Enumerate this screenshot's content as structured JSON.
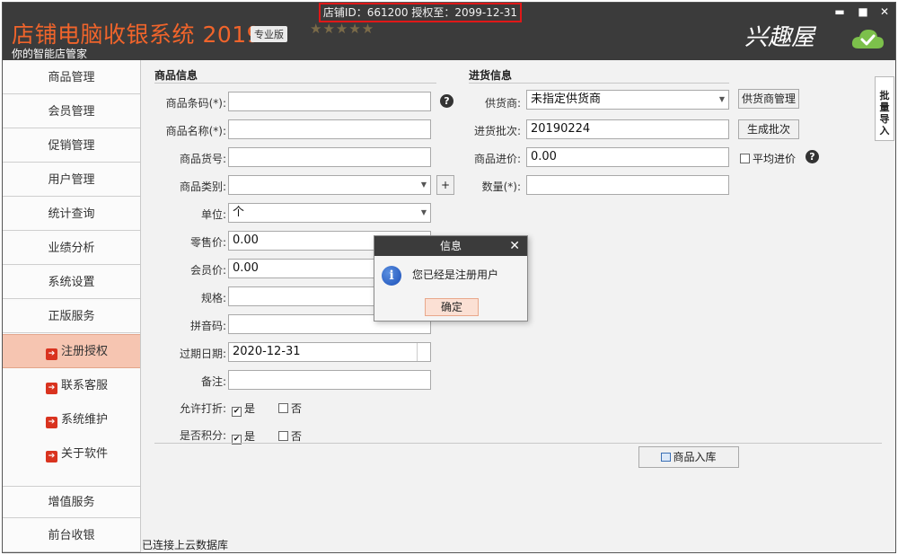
{
  "header": {
    "title": "店铺电脑收银系统 2019",
    "edition": "专业版",
    "subtitle": "你的智能店管家",
    "stars": "★★★★★",
    "license": "店铺ID：661200 授权至：2099-12-31",
    "brand": "兴趣屋",
    "minimize": "▬",
    "maximize": "■",
    "close": "✕"
  },
  "sidebar": {
    "items": [
      "商品管理",
      "会员管理",
      "促销管理",
      "用户管理",
      "统计查询",
      "业绩分析",
      "系统设置",
      "正版服务"
    ],
    "sub_items": [
      "注册授权",
      "联系客服",
      "系统维护",
      "关于软件"
    ],
    "bottom_items": [
      "增值服务",
      "前台收银"
    ]
  },
  "product": {
    "section_title": "商品信息",
    "barcode_label": "商品条码(*):",
    "name_label": "商品名称(*):",
    "sku_label": "商品货号:",
    "category_label": "商品类别:",
    "unit_label": "单位:",
    "unit_value": "个",
    "retail_label": "零售价:",
    "retail_value": "0.00",
    "member_label": "会员价:",
    "member_value": "0.00",
    "spec_label": "规格:",
    "pinyin_label": "拼音码:",
    "expiry_label": "过期日期:",
    "expiry_value": "2020-12-31",
    "remark_label": "备注:",
    "discount_label": "允许打折:",
    "points_label": "是否积分:",
    "yes": "是",
    "no": "否",
    "add_category": "+"
  },
  "purchase": {
    "section_title": "进货信息",
    "supplier_label": "供货商:",
    "supplier_value": "未指定供货商",
    "supplier_btn": "供货商管理",
    "batch_label": "进货批次:",
    "batch_value": "20190224",
    "batch_btn": "生成批次",
    "cost_label": "商品进价:",
    "cost_value": "0.00",
    "avg_label": "平均进价",
    "qty_label": "数量(*):"
  },
  "actions": {
    "stock_in": "商品入库"
  },
  "batch_tab": "批量导入",
  "status": "已连接上云数据库",
  "dialog": {
    "title": "信息",
    "message": "您已经是注册用户",
    "ok": "确定"
  }
}
